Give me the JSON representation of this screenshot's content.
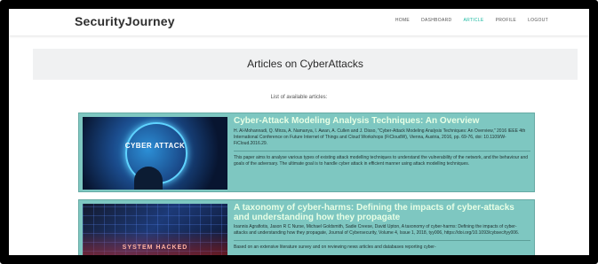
{
  "navbar": {
    "brand": "SecurityJourney",
    "links": [
      {
        "label": "HOME",
        "active": false
      },
      {
        "label": "DASHBOARD",
        "active": false
      },
      {
        "label": "ARTICLE",
        "active": true
      },
      {
        "label": "PROFILE",
        "active": false
      },
      {
        "label": "LOGOUT",
        "active": false
      }
    ]
  },
  "page": {
    "heading": "Articles on CyberAttacks",
    "list_label": "List of available articles:"
  },
  "articles": [
    {
      "image_text": "CYBER ATTACK",
      "title": "Cyber-Attack Modeling Analysis Techniques: An Overview",
      "citation": "H. Al-Mohannadi, Q. Mirza, A. Namanya, I. Awan, A. Cullen and J. Disso, \"Cyber-Attack Modeling Analysis Techniques: An Overview,\" 2016 IEEE 4th International Conference on Future Internet of Things and Cloud Workshops (FiCloudW), Vienna, Austria, 2016, pp. 69-76, doi: 10.1109/W-FiCloud.2016.29.",
      "abstract": "This paper aims to analyse various types of existing attack modelling techniques to understand the vulnerability of the network, and the behaviour and goals of the adversary. The ultimate goal is to handle cyber attack in efficient manner using attack modelling techniques."
    },
    {
      "image_text": "SYSTEM HACKED",
      "title": "A taxonomy of cyber-harms: Defining the impacts of cyber-attacks and understanding how they propagate",
      "citation": "Ioannis Agrafiotis, Jason R C Nurse, Michael Goldsmith, Sadie Creese, David Upton, A taxonomy of cyber-harms: Defining the impacts of cyber-attacks and understanding how they propagate, Journal of Cybersecurity, Volume 4, Issue 1, 2018, tyy006, https://doi.org/10.1093/cybsec/tyy006.",
      "abstract": "Based on an extensive literature survey and on reviewing news articles and databases reporting cyber-"
    }
  ],
  "colors": {
    "accent": "#1bb8a1",
    "card_bg": "#7ec7c1",
    "title_color": "#e8ffe6"
  }
}
